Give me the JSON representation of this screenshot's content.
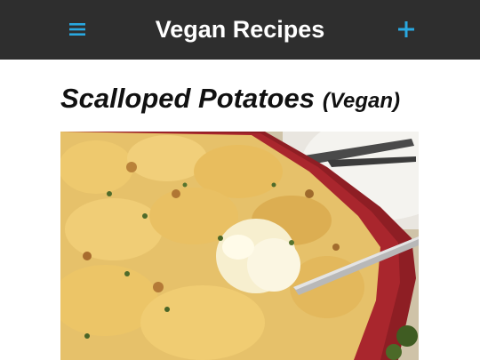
{
  "app": {
    "title": "Vegan Recipes",
    "menu_icon": "hamburger-menu-icon",
    "add_icon": "plus-icon",
    "accent_color": "#29a8e0",
    "header_bg": "#2e2e2e"
  },
  "recipe": {
    "name": "Scalloped Potatoes",
    "qualifier": "(Vegan)",
    "photo": "scalloped-potatoes-photo"
  }
}
